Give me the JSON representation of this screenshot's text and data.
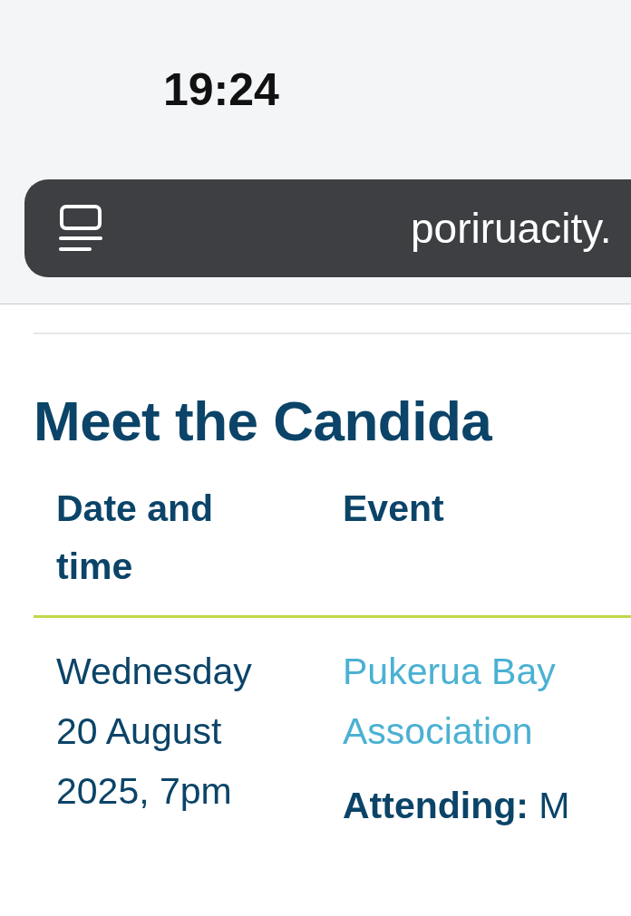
{
  "status_bar": {
    "time": "19:24"
  },
  "address_bar": {
    "url": "poriruacity."
  },
  "heading": "Meet the Candida",
  "table": {
    "columns": [
      "Date and time",
      "Event"
    ],
    "rows": [
      {
        "date": "Wednesday 20 August 2025, 7pm",
        "event": "Pukerua Bay Association",
        "attending": "**Attending:** M"
      }
    ]
  }
}
